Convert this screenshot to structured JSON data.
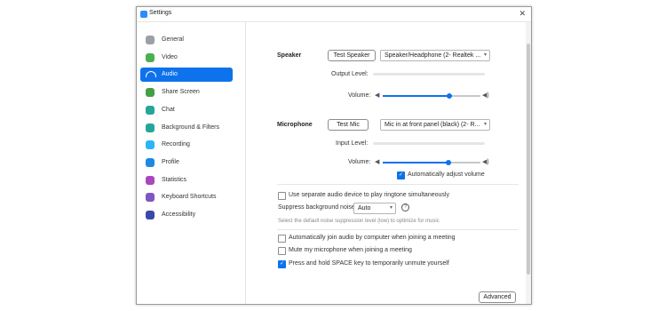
{
  "window": {
    "title": "Settings",
    "close_glyph": "✕"
  },
  "sidebar": {
    "items": [
      {
        "label": "General",
        "icon": "gear-icon",
        "color": "#9aa0a6",
        "active": false
      },
      {
        "label": "Video",
        "icon": "video-icon",
        "color": "#4caf50",
        "active": false
      },
      {
        "label": "Audio",
        "icon": "headphones-icon",
        "color": "#ffffff",
        "active": true
      },
      {
        "label": "Share Screen",
        "icon": "share-screen-icon",
        "color": "#43a047",
        "active": false
      },
      {
        "label": "Chat",
        "icon": "chat-icon",
        "color": "#26a69a",
        "active": false
      },
      {
        "label": "Background & Filters",
        "icon": "background-icon",
        "color": "#26a69a",
        "active": false
      },
      {
        "label": "Recording",
        "icon": "recording-icon",
        "color": "#29b6f6",
        "active": false
      },
      {
        "label": "Profile",
        "icon": "profile-icon",
        "color": "#1e88e5",
        "active": false
      },
      {
        "label": "Statistics",
        "icon": "statistics-icon",
        "color": "#ab47bc",
        "active": false
      },
      {
        "label": "Keyboard Shortcuts",
        "icon": "keyboard-icon",
        "color": "#7e57c2",
        "active": false
      },
      {
        "label": "Accessibility",
        "icon": "accessibility-icon",
        "color": "#3949ab",
        "active": false
      }
    ]
  },
  "speaker": {
    "heading": "Speaker",
    "test_button": "Test Speaker",
    "device": "Speaker/Headphone (2- Realtek ...",
    "output_level_label": "Output Level:",
    "volume_label": "Volume:",
    "volume_fraction": 0.68
  },
  "microphone": {
    "heading": "Microphone",
    "test_button": "Test Mic",
    "device": "Mic in at front panel (black) (2- R...",
    "input_level_label": "Input Level:",
    "volume_label": "Volume:",
    "volume_fraction": 0.67,
    "auto_adjust_label": "Automatically adjust volume",
    "auto_adjust_checked": true
  },
  "ringtone": {
    "label": "Use separate audio device to play ringtone simultaneously",
    "checked": false
  },
  "suppress": {
    "label": "Suppress background noise",
    "value": "Auto",
    "hint": "Select the default noise suppression level (low) to optimize for music"
  },
  "options": [
    {
      "label": "Automatically join audio by computer when joining a meeting",
      "checked": false
    },
    {
      "label": "Mute my microphone when joining a meeting",
      "checked": false
    },
    {
      "label": "Press and hold SPACE key to temporarily unmute yourself",
      "checked": true
    }
  ],
  "advanced_button": "Advanced",
  "colors": {
    "accent": "#0e72ed"
  }
}
